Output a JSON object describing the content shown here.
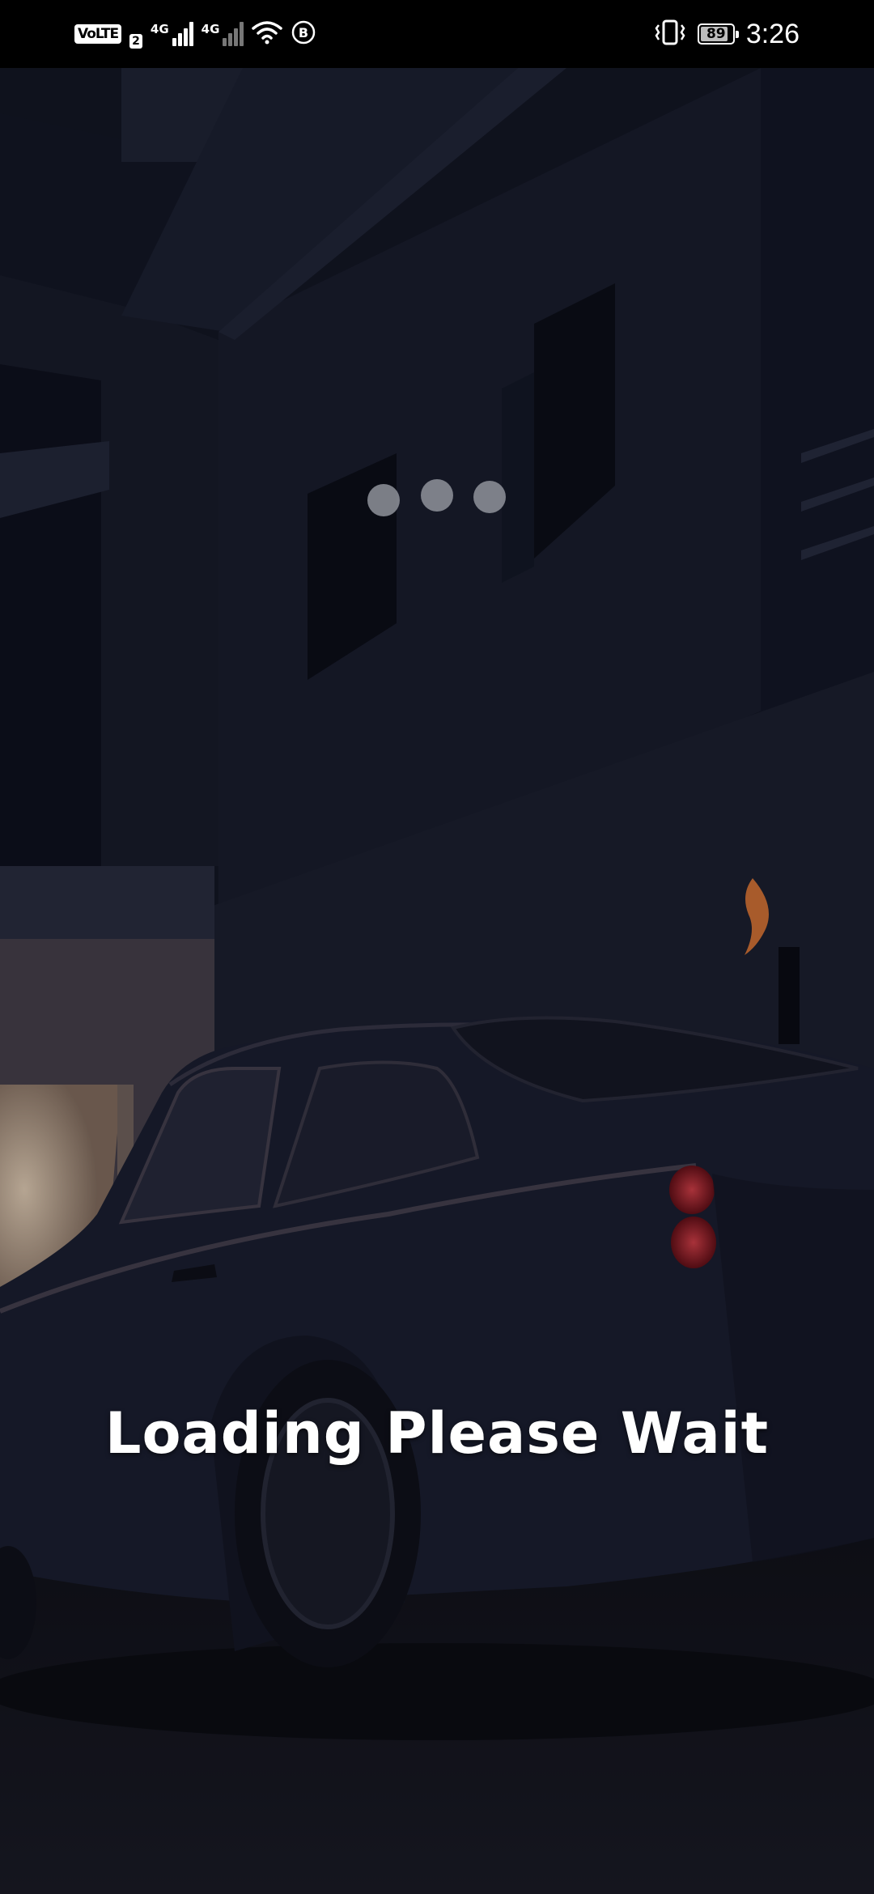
{
  "status_bar": {
    "volte_label": "VoLTE",
    "sim_slot": "2",
    "network_1": "4G",
    "network_2": "4G",
    "wifi_icon": "wifi-icon",
    "b_badge": "B",
    "vibrate_icon": "vibrate-icon",
    "battery_level": "89",
    "time": "3:26"
  },
  "loading": {
    "dots": 3,
    "message": "Loading Please Wait"
  },
  "colors": {
    "scene_dark": "#0b0e18",
    "building": "#1b1f31",
    "car": "#1d2134",
    "window_glow": "#efd8bd",
    "tail_light": "#b2202a",
    "flame": "#e07a3a",
    "dot": "#8f939b",
    "text": "#ffffff"
  }
}
